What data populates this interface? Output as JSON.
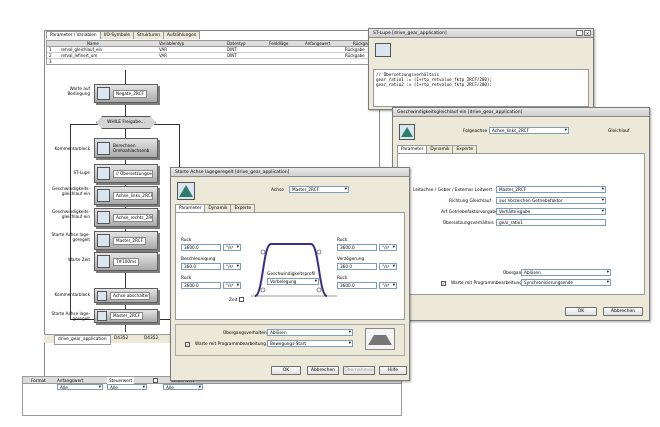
{
  "main": {
    "tabs": [
      "Parameter / Variablen",
      "I/O-Symbole",
      "Strukturen",
      "Aufzählungen"
    ],
    "var_headers": [
      "Name",
      "Variablentyp",
      "Datentyp",
      "Felddläge",
      "Anfangswert",
      "Rückgabe"
    ],
    "var_rows": [
      {
        "no": "1",
        "name": "retval_gleichlauf_ein",
        "vtype": "VAR",
        "dtype": "DINT",
        "ret": "Rückgabe"
      },
      {
        "no": "2",
        "name": "retval_lefinert_um",
        "vtype": "VAR",
        "dtype": "DINT",
        "ret": "Rückgabe"
      },
      {
        "no": "3",
        "name": "",
        "vtype": "",
        "dtype": "",
        "ret": ""
      }
    ],
    "flow": [
      {
        "label": "Warte auf Bedingung",
        "text": "Negate_2RCF"
      },
      {
        "label": "",
        "text": "WHILE Freigabe..."
      },
      {
        "label": "Kommentarblock",
        "text": "Berechnen Drehzahlachsenb"
      },
      {
        "label": "ST-Lupe",
        "text": "// Übersetzungsverhält.ni"
      },
      {
        "label": "Geschwindigkeits-gleichlauf ein",
        "text": "Achse_links_2RCF_GL"
      },
      {
        "label": "Geschwindigkeits-gleichlauf ein",
        "text": "Achse_rechts_2RCF_GL"
      },
      {
        "label": "Starte Achse lage-geregelt",
        "text": "Master_2RCF"
      },
      {
        "label": "Warte Zeit",
        "text": "T#100ms"
      },
      {
        "label": "Kommentarblock",
        "text": "Achse abschalten"
      },
      {
        "label": "Starte Achse lage-geregelt",
        "text": "Master_2RCF"
      }
    ],
    "bottom_tabs": [
      "drive_gear_application",
      "D4352",
      "D4352",
      "D4352"
    ],
    "status_headers": [
      "Format",
      "Anfangswert",
      "Steuerwert",
      "",
      "Steuerwert"
    ],
    "status_values": [
      "Alle",
      "Alle",
      "Alle"
    ]
  },
  "st_window": {
    "title": "ST-Lupe [drive_gear_application]",
    "code": [
      "// Übersetzungsverhältnis",
      "gear_ratio1 := (1+rtp_retvalue_fktp_2RCF/200);",
      "gear_ratio2 := (1+rtp_retvalue_fktp_2RCF/200);"
    ]
  },
  "gl_window": {
    "title": "Geschwindigkeitsgleichlauf ein [drive_gear_application]",
    "folgeachse_label": "Folgeachse",
    "folgeachse_value": "Achse_links_2RCF",
    "gleichlauf_label": "Gleichlauf",
    "tabs": [
      "Parameter",
      "Dynamik",
      "Experte"
    ],
    "rows": [
      {
        "label": "Leitachse / Geber / Externer Leitwert",
        "value": "Master_2RCF"
      },
      {
        "label": "Richtung Gleichlauf",
        "value": "aus Vorzeichen Getriebefaktor"
      },
      {
        "label": "Art Getriebefaktorvorgabe",
        "value": "Verhältnisgabe"
      },
      {
        "label": "Übersetzungsverhältnis",
        "value": "gear_ratio1"
      }
    ],
    "uebergang_label": "Übergangsverhalten",
    "uebergang_value": "Ablösen",
    "warte_label": "Warte mit Programmbearbeitung",
    "warte_value": "Synchronisierungsende",
    "ok": "OK",
    "cancel": "Abbrechen"
  },
  "lage_window": {
    "title": "Starte Achse lagegeregelt [drive_gear_application]",
    "achse_label": "Achse",
    "achse_value": "Master_2RCF",
    "tabs": [
      "Parameter",
      "Dynamik",
      "Experte"
    ],
    "ruck_label": "Ruck",
    "ruck_left_value": "3600.0",
    "ruck_left_unit": "°/s³",
    "beschl_label": "Beschleunigung",
    "beschl_value": "360.0",
    "beschl_unit": "°/s²",
    "ruck2_label": "Ruck",
    "ruck2_value": "3600.0",
    "ruck2_unit": "°/s³",
    "profile_label": "Geschwindigkeitsprofil",
    "profile_value": "Vorbelegung",
    "zeit_label": "Zeit",
    "ruck_r_label": "Ruck",
    "ruck_r_value": "3600.0",
    "ruck_r_unit": "°/s³",
    "verz_label": "Verzögerung",
    "verz_value": "360.0",
    "verz_unit": "°/s²",
    "ruck_r2_label": "Ruck",
    "ruck_r2_value": "3600.0",
    "ruck_r2_unit": "°/s³",
    "uebergang_label": "Übergangsverhalten",
    "uebergang_value": "Ablösen",
    "warte_label": "Warte mit Programmbearbeitung",
    "warte_value": "Bewegungs-Start",
    "ok": "OK",
    "cancel": "Abbrechen",
    "apply": "Übernehmen",
    "help": "Hilfe"
  }
}
